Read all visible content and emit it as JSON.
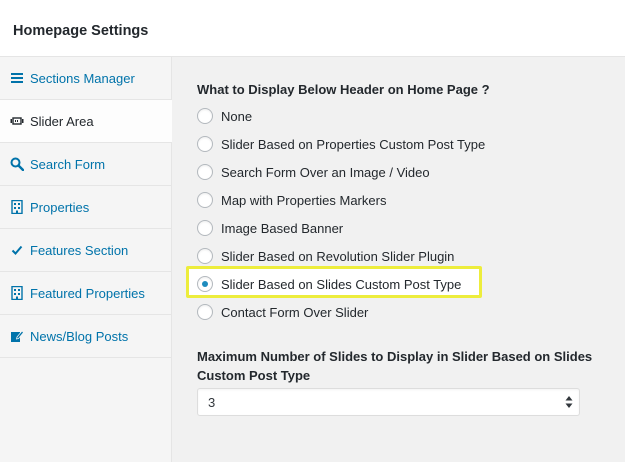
{
  "header": {
    "title": "Homepage Settings"
  },
  "sidebar": {
    "items": [
      {
        "label": "Sections Manager",
        "icon": "list-icon",
        "active": false
      },
      {
        "label": "Slider Area",
        "icon": "slider-icon",
        "active": true
      },
      {
        "label": "Search Form",
        "icon": "search-icon",
        "active": false
      },
      {
        "label": "Properties",
        "icon": "building-icon",
        "active": false
      },
      {
        "label": "Features Section",
        "icon": "checkmark-icon",
        "active": false
      },
      {
        "label": "Featured Properties",
        "icon": "building-icon",
        "active": false
      },
      {
        "label": "News/Blog Posts",
        "icon": "edit-icon",
        "active": false
      }
    ]
  },
  "main": {
    "question": "What to Display Below Header on Home Page ?",
    "options": [
      "None",
      "Slider Based on Properties Custom Post Type",
      "Search Form Over an Image / Video",
      "Map with Properties Markers",
      "Image Based Banner",
      "Slider Based on Revolution Slider Plugin",
      "Slider Based on Slides Custom Post Type",
      "Contact Form Over Slider"
    ],
    "selected_option": "Slider Based on Slides Custom Post Type",
    "highlight_color": "#eded3c",
    "accent_color": "#0073aa",
    "slides_label": "Maximum Number of Slides to Display in Slider Based on Slides Custom Post Type",
    "slides_select_value": "3"
  }
}
